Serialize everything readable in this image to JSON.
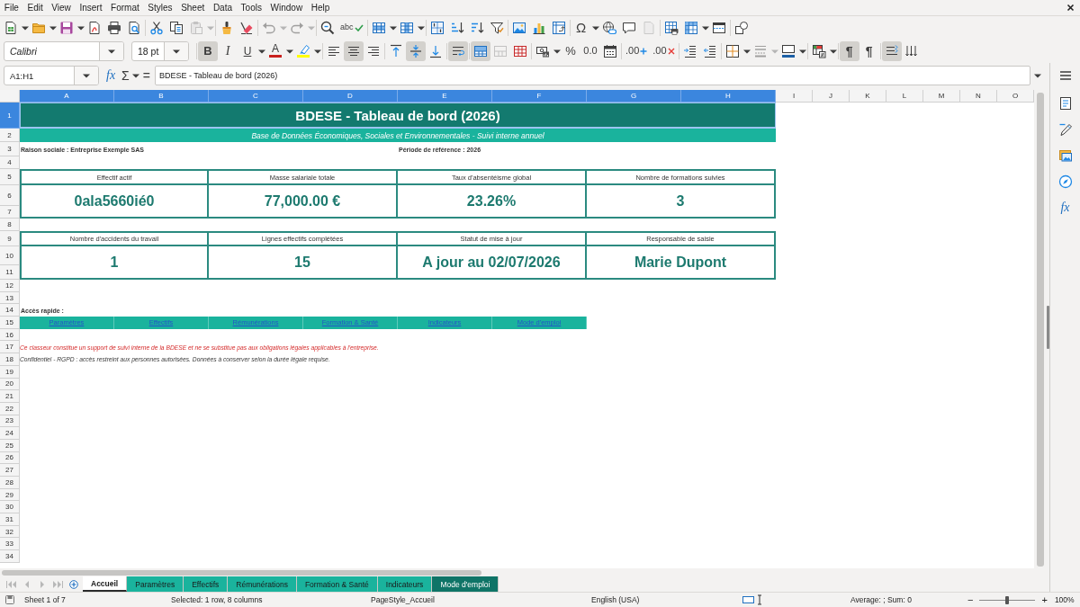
{
  "menu_bar": {
    "items": [
      "File",
      "Edit",
      "View",
      "Insert",
      "Format",
      "Styles",
      "Sheet",
      "Data",
      "Tools",
      "Window",
      "Help"
    ]
  },
  "standard_toolbar": {
    "groups": [
      [
        {
          "kind": "new",
          "dropdown": true,
          "disabled": false
        },
        {
          "kind": "open",
          "dropdown": true,
          "disabled": false
        },
        {
          "kind": "save",
          "dropdown": true,
          "disabled": false
        },
        {
          "kind": "export_pdf",
          "dropdown": false,
          "disabled": false
        },
        {
          "kind": "print",
          "dropdown": false,
          "disabled": false
        },
        {
          "kind": "print_preview",
          "dropdown": false,
          "disabled": false
        }
      ],
      [
        {
          "kind": "cut",
          "dropdown": false,
          "disabled": false
        },
        {
          "kind": "copy",
          "dropdown": false,
          "disabled": false
        },
        {
          "kind": "paste",
          "dropdown": true,
          "disabled": true
        }
      ],
      [
        {
          "kind": "clone_formatting",
          "dropdown": false,
          "disabled": false
        },
        {
          "kind": "clear_formatting",
          "dropdown": false,
          "disabled": false
        }
      ],
      [
        {
          "kind": "undo",
          "dropdown": true,
          "disabled": true
        },
        {
          "kind": "redo",
          "dropdown": true,
          "disabled": true
        }
      ],
      [
        {
          "kind": "find_replace",
          "dropdown": false,
          "disabled": false
        },
        {
          "kind": "spelling",
          "glyph": "abc",
          "dropdown": false,
          "disabled": false
        }
      ],
      [
        {
          "kind": "row",
          "dropdown": true,
          "disabled": false
        },
        {
          "kind": "column",
          "dropdown": true,
          "disabled": false
        }
      ],
      [
        {
          "kind": "sort",
          "dropdown": false,
          "disabled": false
        },
        {
          "kind": "sort_ascending",
          "dropdown": false,
          "disabled": false
        },
        {
          "kind": "sort_descending",
          "dropdown": false,
          "disabled": false
        },
        {
          "kind": "autofilter",
          "dropdown": false,
          "disabled": false
        }
      ],
      [
        {
          "kind": "image",
          "dropdown": false,
          "disabled": false
        },
        {
          "kind": "chart",
          "dropdown": false,
          "disabled": false
        },
        {
          "kind": "pivot_table",
          "dropdown": false,
          "disabled": false
        }
      ],
      [
        {
          "kind": "special_character",
          "glyph": "Ω",
          "dropdown": true,
          "disabled": false
        },
        {
          "kind": "hyperlink",
          "dropdown": false,
          "disabled": false
        },
        {
          "kind": "comment",
          "dropdown": false,
          "disabled": false
        },
        {
          "kind": "header_footer",
          "dropdown": false,
          "disabled": true
        }
      ],
      [
        {
          "kind": "print_area",
          "dropdown": false,
          "disabled": false
        },
        {
          "kind": "freeze",
          "dropdown": true,
          "disabled": false
        },
        {
          "kind": "split_window",
          "dropdown": false,
          "disabled": false
        }
      ],
      [
        {
          "kind": "shapes",
          "dropdown": false,
          "disabled": false
        }
      ]
    ]
  },
  "formatting_toolbar": {
    "font_name": "Calibri",
    "font_size": "18 pt",
    "groups": [
      [
        {
          "kind": "bold",
          "glyph": "B",
          "dropdown": false,
          "on": true,
          "disabled": false
        },
        {
          "kind": "italic",
          "glyph": "I",
          "dropdown": false,
          "on": false,
          "disabled": false
        },
        {
          "kind": "underline",
          "glyph": "U",
          "dropdown": true,
          "on": false,
          "disabled": false
        },
        {
          "kind": "font_color",
          "glyph": "A",
          "color": "#c9211e",
          "dropdown": true,
          "on": false,
          "disabled": false
        },
        {
          "kind": "highlight",
          "color": "#ffff00",
          "dropdown": true,
          "on": false,
          "disabled": false
        }
      ],
      [
        {
          "kind": "align_left",
          "dropdown": false,
          "on": false,
          "disabled": false
        },
        {
          "kind": "align_center",
          "dropdown": false,
          "on": true,
          "disabled": false
        },
        {
          "kind": "align_right",
          "dropdown": false,
          "on": false,
          "disabled": false
        }
      ],
      [
        {
          "kind": "align_top",
          "dropdown": false,
          "on": false,
          "disabled": false
        },
        {
          "kind": "align_middle",
          "dropdown": false,
          "on": true,
          "disabled": false
        },
        {
          "kind": "align_bottom",
          "dropdown": false,
          "on": false,
          "disabled": false
        }
      ],
      [
        {
          "kind": "wrap_text",
          "dropdown": false,
          "on": true,
          "disabled": false
        }
      ],
      [
        {
          "kind": "merge_center",
          "dropdown": false,
          "on": true,
          "disabled": false
        },
        {
          "kind": "merge",
          "dropdown": false,
          "on": false,
          "disabled": true
        },
        {
          "kind": "unmerge",
          "dropdown": false,
          "on": false,
          "disabled": false
        }
      ],
      [
        {
          "kind": "currency",
          "dropdown": true,
          "on": false,
          "disabled": false
        },
        {
          "kind": "percent",
          "glyph": "%",
          "dropdown": false,
          "on": false,
          "disabled": false
        },
        {
          "kind": "number",
          "glyph": "0.0",
          "dropdown": false,
          "on": false,
          "disabled": false
        },
        {
          "kind": "date",
          "dropdown": false,
          "on": false,
          "disabled": false
        }
      ],
      [
        {
          "kind": "add_decimal",
          "glyph": ".00",
          "dropdown": false,
          "on": false,
          "disabled": false
        },
        {
          "kind": "delete_decimal",
          "glyph": ".00",
          "dropdown": false,
          "on": false,
          "disabled": false
        }
      ],
      [
        {
          "kind": "indent_increase",
          "dropdown": false,
          "on": false,
          "disabled": false
        },
        {
          "kind": "indent_decrease",
          "dropdown": false,
          "on": false,
          "disabled": false
        }
      ],
      [
        {
          "kind": "borders",
          "dropdown": true,
          "on": false,
          "disabled": false
        },
        {
          "kind": "border_style",
          "dropdown": true,
          "on": false,
          "disabled": true
        },
        {
          "kind": "border_color",
          "color": "#1c5fa5",
          "dropdown": true,
          "on": false,
          "disabled": false
        }
      ],
      [
        {
          "kind": "conditional",
          "dropdown": true,
          "on": false,
          "disabled": false
        }
      ],
      [
        {
          "kind": "ltr",
          "glyph": "¶",
          "dropdown": false,
          "on": true,
          "disabled": false
        },
        {
          "kind": "rtl",
          "glyph": "¶",
          "dropdown": false,
          "on": false,
          "disabled": false
        }
      ],
      [
        {
          "kind": "text_direction",
          "dropdown": false,
          "on": true,
          "disabled": false
        },
        {
          "kind": "vertical_text",
          "dropdown": false,
          "on": false,
          "disabled": false
        }
      ]
    ]
  },
  "formula_bar": {
    "name_box": "A1:H1",
    "function_wizard": "fx",
    "sum": "Σ",
    "equals": "=",
    "content": "BDESE - Tableau de bord (2026)"
  },
  "sheet": {
    "columns": [
      {
        "label": "A",
        "selected": true
      },
      {
        "label": "B",
        "selected": true
      },
      {
        "label": "C",
        "selected": true
      },
      {
        "label": "D",
        "selected": true
      },
      {
        "label": "E",
        "selected": true
      },
      {
        "label": "F",
        "selected": true
      },
      {
        "label": "G",
        "selected": true
      },
      {
        "label": "H",
        "selected": true
      },
      {
        "label": "I",
        "selected": false
      },
      {
        "label": "J",
        "selected": false
      },
      {
        "label": "K",
        "selected": false
      },
      {
        "label": "L",
        "selected": false
      },
      {
        "label": "M",
        "selected": false
      },
      {
        "label": "N",
        "selected": false
      },
      {
        "label": "O",
        "selected": false
      }
    ],
    "rows": [
      {
        "label": "1",
        "selected": true
      },
      {
        "label": "2",
        "selected": false
      },
      {
        "label": "3",
        "selected": false
      },
      {
        "label": "4",
        "selected": false
      },
      {
        "label": "5",
        "selected": false
      },
      {
        "label": "6",
        "selected": false
      },
      {
        "label": "7",
        "selected": false
      },
      {
        "label": "8",
        "selected": false
      },
      {
        "label": "9",
        "selected": false
      },
      {
        "label": "10",
        "selected": false
      },
      {
        "label": "11",
        "selected": false
      },
      {
        "label": "12",
        "selected": false
      },
      {
        "label": "13",
        "selected": false
      },
      {
        "label": "14",
        "selected": false
      },
      {
        "label": "15",
        "selected": false
      },
      {
        "label": "16",
        "selected": false
      },
      {
        "label": "17",
        "selected": false
      },
      {
        "label": "18",
        "selected": false
      },
      {
        "label": "19",
        "selected": false
      },
      {
        "label": "20",
        "selected": false
      },
      {
        "label": "21",
        "selected": false
      },
      {
        "label": "22",
        "selected": false
      },
      {
        "label": "23",
        "selected": false
      },
      {
        "label": "24",
        "selected": false
      },
      {
        "label": "25",
        "selected": false
      },
      {
        "label": "26",
        "selected": false
      },
      {
        "label": "27",
        "selected": false
      },
      {
        "label": "28",
        "selected": false
      },
      {
        "label": "29",
        "selected": false
      },
      {
        "label": "30",
        "selected": false
      },
      {
        "label": "31",
        "selected": false
      },
      {
        "label": "32",
        "selected": false
      },
      {
        "label": "33",
        "selected": false
      },
      {
        "label": "34",
        "selected": false
      }
    ],
    "title": {
      "text": "BDESE - Tableau de bord (2026)",
      "selected": true
    },
    "subtitle": "Base de Données Économiques, Sociales et Environnementales - Suivi interne annuel",
    "company": "Raison sociale : Entreprise Exemple SAS",
    "period": "Période de référence : 2026",
    "kpi_rows": [
      [
        {
          "label": "Effectif actif",
          "value": "0ala5660ié0"
        },
        {
          "label": "Masse salariale totale",
          "value": "77,000.00 €"
        },
        {
          "label": "Taux d'absentéisme global",
          "value": "23.26%"
        },
        {
          "label": "Nombre de formations suivies",
          "value": "3"
        }
      ],
      [
        {
          "label": "Nombre d'accidents du travail",
          "value": "1"
        },
        {
          "label": "Lignes effectifs complétées",
          "value": "15"
        },
        {
          "label": "Statut de mise à jour",
          "value": "A jour au 02/07/2026"
        },
        {
          "label": "Responsable de saisie",
          "value": "Marie Dupont"
        }
      ]
    ],
    "quick_access": {
      "label": "Accès rapide :",
      "links": [
        "Paramètres",
        "Effectifs",
        "Rémunérations",
        "Formation & Santé",
        "Indicateurs",
        "Mode d'emploi"
      ]
    },
    "notes": [
      {
        "text": "Ce classeur constitue un support de suivi interne de la BDESE et ne se substitue pas aux obligations légales applicables à l'entreprise.",
        "kind": "warning"
      },
      {
        "text": "Confidentiel - RGPD : accès restreint aux personnes autorisées. Données à conserver selon la durée légale requise.",
        "kind": "notice"
      }
    ]
  },
  "sheet_tab_bar": {
    "navigation_disabled": true,
    "tabs": [
      {
        "label": "Accueil",
        "selected": true
      },
      {
        "label": "Paramètres",
        "selected": false,
        "color": "#1ab39d"
      },
      {
        "label": "Effectifs",
        "selected": false,
        "color": "#1ab39d"
      },
      {
        "label": "Rémunérations",
        "selected": false,
        "color": "#1ab39d"
      },
      {
        "label": "Formation & Santé",
        "selected": false,
        "color": "#1ab39d"
      },
      {
        "label": "Indicateurs",
        "selected": false,
        "color": "#1ab39d"
      },
      {
        "label": "Mode d'emploi",
        "selected": false,
        "color": "#0f7467"
      }
    ]
  },
  "sidebar": {
    "functions": "fx"
  },
  "status_bar": {
    "sheet": "Sheet 1 of 7",
    "selection": "Selected: 1 row, 8 columns",
    "page_style": "PageStyle_Accueil",
    "language": "English (USA)",
    "summary": "Average: ; Sum: 0",
    "zoom": {
      "out": "−",
      "level": 0.5,
      "in": "+",
      "value": "100%"
    }
  }
}
